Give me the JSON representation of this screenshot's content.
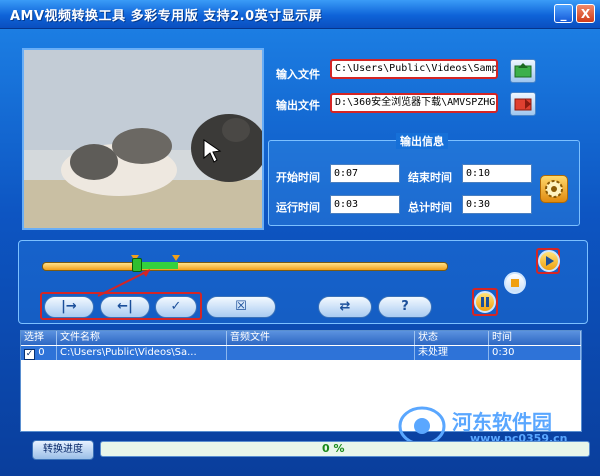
{
  "window": {
    "title": "AMV视频转换工具 多彩专用版 支持2.0英寸显示屏",
    "minimize_label": "_",
    "close_label": "X"
  },
  "io": {
    "input_label": "输入文件",
    "input_value": "C:\\Users\\Public\\Videos\\Sample",
    "output_label": "输出文件",
    "output_value": "D:\\360安全浏览器下载\\AMVSPZHG"
  },
  "info": {
    "title": "输出信息",
    "start_label": "开始时间",
    "start_value": "0:07",
    "end_label": "结束时间",
    "end_value": "0:10",
    "run_label": "运行时间",
    "run_value": "0:03",
    "total_label": "总计时间",
    "total_value": "0:30"
  },
  "controls": {
    "set_start": "|→",
    "set_end": "←|",
    "confirm": "✓",
    "remove": "☒",
    "convert": "⇄",
    "help": "?"
  },
  "playback": {
    "selection_start_fraction": 0.233,
    "selection_end_fraction": 0.333
  },
  "table": {
    "headers": [
      "选择",
      "文件名称",
      "音频文件",
      "状态",
      "时间"
    ],
    "rows": [
      {
        "select": "0",
        "file": "C:\\Users\\Public\\Videos\\Sa...",
        "audio": "",
        "status": "未处理",
        "time": "0:30"
      }
    ]
  },
  "footer": {
    "progress_button": "转换进度",
    "progress_text": "0 %",
    "progress_value": 0
  },
  "watermark": {
    "site": "河东软件园",
    "url": "www.pc0359.cn"
  },
  "colors": {
    "highlight": "#d42525",
    "accent": "#0e63d8"
  }
}
